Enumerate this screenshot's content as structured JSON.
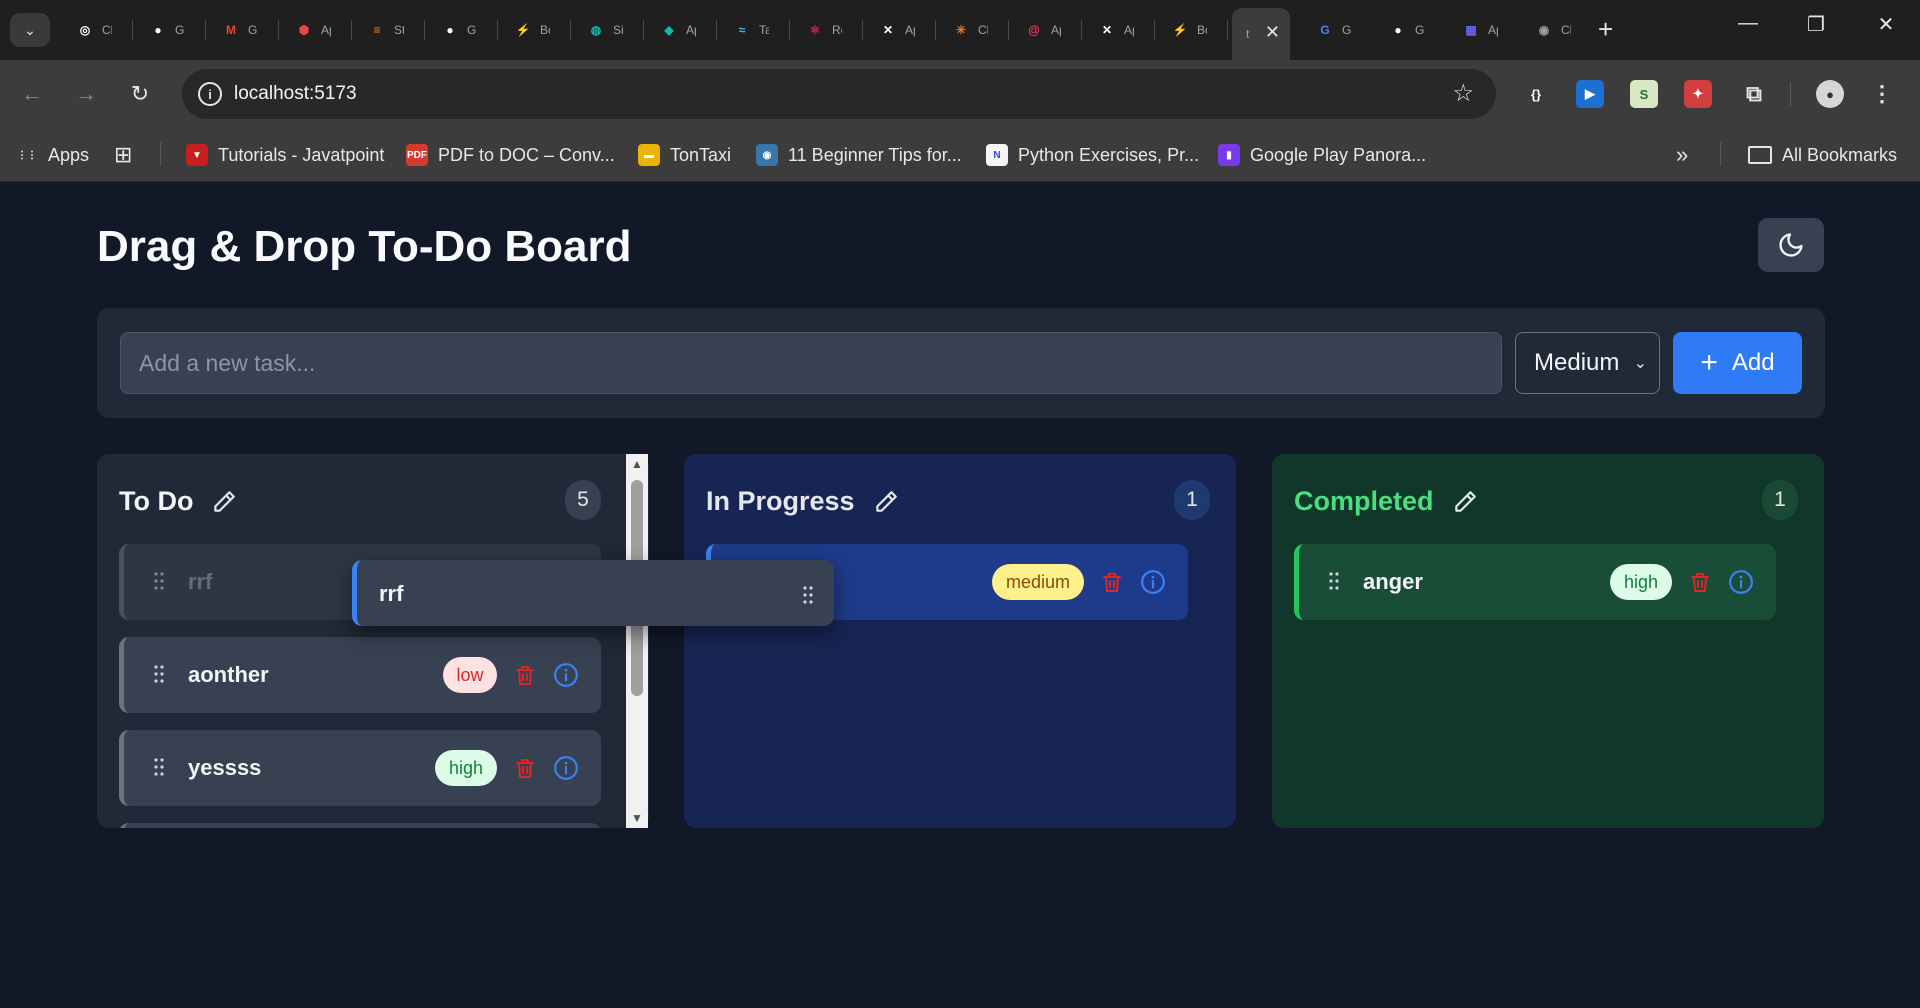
{
  "browser": {
    "tabs": [
      {
        "icon": "chatgpt-icon",
        "color": "#ffffff",
        "glyph": "◎",
        "label": "ChatGPT"
      },
      {
        "icon": "github-icon",
        "color": "#ffffff",
        "glyph": "●",
        "label": "GitHub"
      },
      {
        "icon": "gmail-icon",
        "color": "#ea4335",
        "glyph": "M",
        "label": "Gmail"
      },
      {
        "icon": "app-hexagon-icon",
        "color": "#ef4444",
        "glyph": "⬢",
        "label": "App"
      },
      {
        "icon": "stackoverflow-icon",
        "color": "#f48024",
        "glyph": "≡",
        "label": "Stack Overflow"
      },
      {
        "icon": "github-icon",
        "color": "#ffffff",
        "glyph": "●",
        "label": "GitHub"
      },
      {
        "icon": "bolt-circle-icon",
        "color": "#22c55e",
        "glyph": "⚡",
        "label": "Bolt"
      },
      {
        "icon": "globe-icon",
        "color": "#14b8a6",
        "glyph": "◍",
        "label": "Site"
      },
      {
        "icon": "diamond-icon",
        "color": "#14b8a6",
        "glyph": "◆",
        "label": "App"
      },
      {
        "icon": "tailwind-icon",
        "color": "#38bdf8",
        "glyph": "≈",
        "label": "Tailwind CSS"
      },
      {
        "icon": "react-icon",
        "color": "#e11d48",
        "glyph": "⚛",
        "label": "React"
      },
      {
        "icon": "crossed-circle-icon",
        "color": "#ffffff",
        "glyph": "✕",
        "label": "App"
      },
      {
        "icon": "claude-icon",
        "color": "#f97316",
        "glyph": "✳",
        "label": "Claude"
      },
      {
        "icon": "swirl-icon",
        "color": "#f43f5e",
        "glyph": "@",
        "label": "App"
      },
      {
        "icon": "crossed-circle-icon",
        "color": "#ffffff",
        "glyph": "✕",
        "label": "App"
      },
      {
        "icon": "bolt-icon",
        "color": "#22c55e",
        "glyph": "⚡",
        "label": "Bolt"
      }
    ],
    "tabs_after": [
      {
        "icon": "google-icon",
        "color": "#4285f4",
        "glyph": "G",
        "label": "Google"
      },
      {
        "icon": "github-icon",
        "color": "#ffffff",
        "glyph": "●",
        "label": "GitHub"
      },
      {
        "icon": "calendar-app-icon",
        "color": "#6366f1",
        "glyph": "▦",
        "label": "App"
      },
      {
        "icon": "chrome-icon",
        "color": "#9ca3af",
        "glyph": "◉",
        "label": "Chrome"
      }
    ],
    "active_tab_label": "t",
    "address": "localhost:5173",
    "extensions": [
      {
        "icon": "json-viewer-icon",
        "color": "#3c3c3c",
        "glyph": "{}"
      },
      {
        "icon": "cast-extension-icon",
        "color": "#1d6fd1",
        "glyph": "▶"
      },
      {
        "icon": "sheet-extension-icon",
        "color": "#d9e8c4",
        "glyph": "S"
      },
      {
        "icon": "red-puzzle-icon",
        "color": "#d23f3f",
        "glyph": "✦"
      }
    ],
    "bookmarks": [
      {
        "icon": "apps-grid-icon",
        "color": "#3c3c3c",
        "glyph": "⋮⋮",
        "label": "Apps"
      },
      {
        "icon": "tutorials-icon",
        "color": "#c81e1e",
        "glyph": "▼",
        "label": "Tutorials - Javatpoint"
      },
      {
        "icon": "pdf-icon",
        "color": "#d43a2f",
        "glyph": "PDF",
        "label": "PDF to DOC – Conv..."
      },
      {
        "icon": "taxi-icon",
        "color": "#eab308",
        "glyph": "▬",
        "label": "TonTaxi"
      },
      {
        "icon": "python-icon",
        "color": "#3776ab",
        "glyph": "◉",
        "label": "11 Beginner Tips for..."
      },
      {
        "icon": "pynative-icon",
        "color": "#f5f5f5",
        "glyph": "N",
        "label": "Python Exercises, Pr..."
      },
      {
        "icon": "play-panorama-icon",
        "color": "#7c3aed",
        "glyph": "▮",
        "label": "Google Play Panora..."
      }
    ],
    "all_bookmarks_label": "All Bookmarks"
  },
  "app": {
    "title": "Drag & Drop To-Do Board",
    "input_placeholder": "Add a new task...",
    "priority_selected": "Medium",
    "add_label": "Add",
    "drag_preview": {
      "title": "rrf"
    }
  },
  "columns": [
    {
      "title": "To Do",
      "count": "5",
      "title_color": "#f3f4f6",
      "cards": [
        {
          "title": "rrf",
          "priority": "",
          "placeholder": true
        },
        {
          "title": "aonther",
          "priority": "low",
          "priority_text_color": "#dc2626",
          "priority_bg": "#fee2e2"
        },
        {
          "title": "yessss",
          "priority": "high",
          "priority_text_color": "#15803d",
          "priority_bg": "#dcfce7"
        }
      ]
    },
    {
      "title": "In Progress",
      "count": "1",
      "title_color": "#e5e7eb",
      "cards": [
        {
          "title": "",
          "priority": "medium",
          "priority_text_color": "#854d0e",
          "priority_bg": "#fef08a"
        }
      ]
    },
    {
      "title": "Completed",
      "count": "1",
      "title_color": "#4ade80",
      "cards": [
        {
          "title": "anger",
          "priority": "high",
          "priority_text_color": "#15803d",
          "priority_bg": "#dcfce7"
        }
      ]
    }
  ]
}
